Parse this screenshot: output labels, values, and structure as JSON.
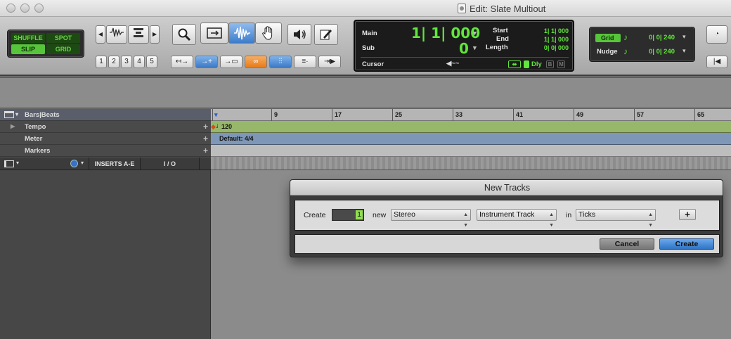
{
  "window": {
    "title": "Edit: Slate Multiout"
  },
  "edit_modes": {
    "shuffle": "SHUFFLE",
    "spot": "SPOT",
    "slip": "SLIP",
    "grid": "GRID"
  },
  "track_numbers": [
    "1",
    "2",
    "3",
    "4",
    "5"
  ],
  "counter": {
    "main_label": "Main",
    "main_value": "1| 1| 000",
    "sub_label": "Sub",
    "sub_value": "0",
    "start_label": "Start",
    "start_value": "1| 1| 000",
    "end_label": "End",
    "end_value": "1| 1| 000",
    "length_label": "Length",
    "length_value": "0| 0| 000",
    "cursor_label": "Cursor",
    "dly_label": "Dly",
    "b_label": "B",
    "m_label": "M"
  },
  "grid_panel": {
    "grid_label": "Grid",
    "grid_value": "0| 0| 240",
    "nudge_label": "Nudge",
    "nudge_value": "0| 0| 240"
  },
  "rulers": {
    "bars_beats_label": "Bars|Beats",
    "tempo_label": "Tempo",
    "meter_label": "Meter",
    "markers_label": "Markers",
    "tempo_value": "120",
    "meter_value": "Default: 4/4",
    "bar_numbers": [
      "1",
      "9",
      "17",
      "25",
      "33",
      "41",
      "49",
      "57",
      "65"
    ]
  },
  "track_header": {
    "inserts": "INSERTS A-E",
    "io": "I / O"
  },
  "dialog": {
    "title": "New Tracks",
    "create_label": "Create",
    "count_value": "1",
    "new_label": "new",
    "format": "Stereo",
    "track_type": "Instrument Track",
    "in_label": "in",
    "timebase": "Ticks",
    "add_label": "+",
    "cancel_label": "Cancel",
    "create_button_label": "Create"
  },
  "colors": {
    "counter_green": "#61e63c",
    "tempo_lane": "#97b76a",
    "meter_lane": "#7e97b6",
    "create_button": "#3f85d2"
  }
}
